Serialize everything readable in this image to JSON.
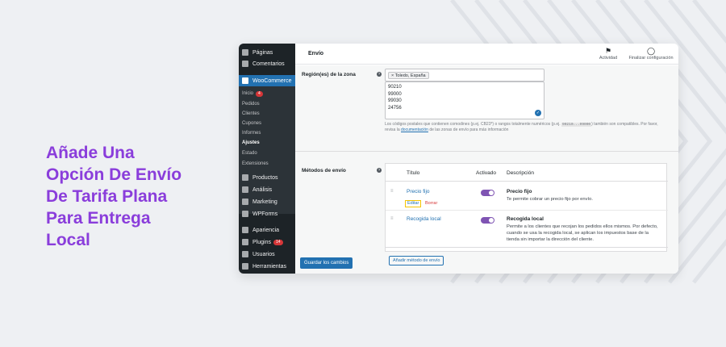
{
  "headline": [
    "Añade Una",
    "Opción De Envío",
    "De Tarifa Plana",
    "Para Entrega",
    "Local"
  ],
  "sidebar": {
    "items_top": [
      {
        "label": "Páginas",
        "icon": "pages-icon"
      },
      {
        "label": "Comentarios",
        "icon": "comments-icon"
      }
    ],
    "woocommerce": "WooCommerce",
    "submenu": [
      {
        "label": "Inicio",
        "badge": "4"
      },
      {
        "label": "Pedidos"
      },
      {
        "label": "Clientes"
      },
      {
        "label": "Cupones"
      },
      {
        "label": "Informes"
      },
      {
        "label": "Ajustes"
      },
      {
        "label": "Estado"
      },
      {
        "label": "Extensiones"
      }
    ],
    "items_bottom": [
      {
        "label": "Productos",
        "icon": "products-icon"
      },
      {
        "label": "Análisis",
        "icon": "analytics-icon"
      },
      {
        "label": "Marketing",
        "icon": "marketing-icon"
      },
      {
        "label": "WPForms",
        "icon": "wpforms-icon"
      },
      {
        "label": "Apariencia",
        "icon": "appearance-icon"
      },
      {
        "label": "Plugins",
        "icon": "plugins-icon",
        "badge": "14"
      },
      {
        "label": "Usuarios",
        "icon": "users-icon"
      },
      {
        "label": "Herramientas",
        "icon": "tools-icon"
      }
    ]
  },
  "topbar": {
    "title": "Envío",
    "activity": "Actividad",
    "finish_setup": "Finalizar configuración"
  },
  "zone": {
    "region_label": "Región(es) de la zona",
    "region_chip": "× Toledo, España",
    "postcodes": [
      "90210",
      "99000",
      "99030",
      "24756"
    ],
    "hint_pre": "Los códigos postales que contienen comodines (p.ej. CB23*) o rangos totalmente numéricos (p.ej.",
    "hint_code": "90210...99000",
    "hint_mid": ") también son compatibles. Por favor, revisa la",
    "hint_link": "documentación",
    "hint_post": "de las zonas de envío para más información"
  },
  "methods": {
    "label": "Métodos de envío",
    "col_title": "Título",
    "col_enabled": "Activado",
    "col_description": "Descripción",
    "rows": [
      {
        "name": "Precio fijo",
        "desc_title": "Precio fijo",
        "desc": "Te permite cobrar un precio fijo por envío.",
        "edit": "Editar",
        "delete": "Borrar"
      },
      {
        "name": "Recogida local",
        "desc_title": "Recogida local",
        "desc": "Permite a los clientes que recojan los pedidos ellos mismos. Por defecto, cuando se usa la recogida local, se aplican los impuestos base de la tienda sin importar la dirección del cliente."
      }
    ],
    "add_button": "Añadir método de envío"
  },
  "save_button": "Guardar los cambios",
  "colors": {
    "accent": "#8a3ddb",
    "wp_blue": "#2271b1",
    "toggle_on": "#7f54b3",
    "sidebar_bg": "#1d2327"
  }
}
